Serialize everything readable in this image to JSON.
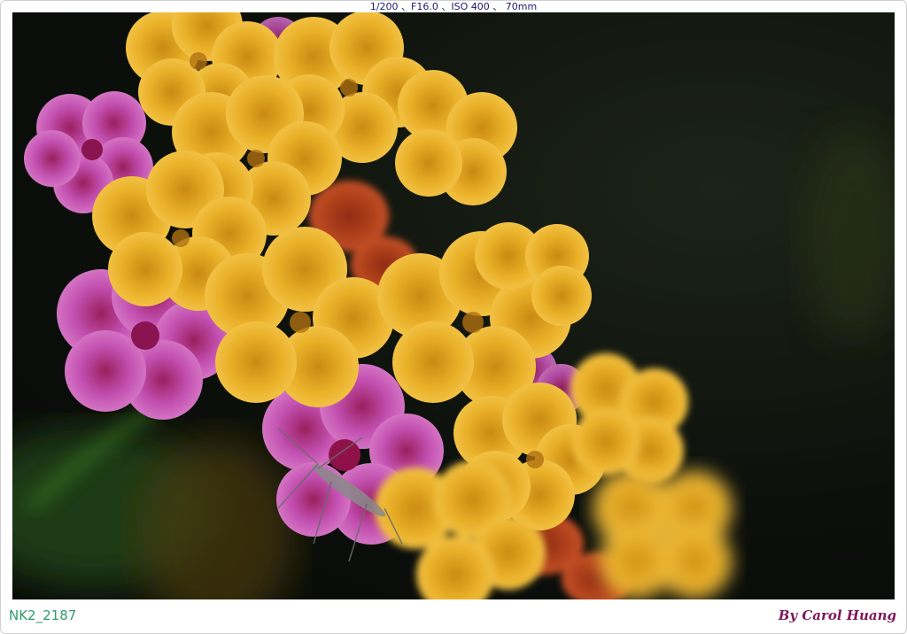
{
  "exif": {
    "text": "1/200 、F16.0 、ISO 400 、 70mm"
  },
  "photo": {
    "subject": "lantana-flower-cluster",
    "colors": {
      "background": "#0c100b",
      "yellow_petal": "#e8a920",
      "yellow_petal_light": "#f4c54a",
      "pink_petal": "#c24fb0",
      "pink_petal_light": "#d978c8",
      "orange_bud": "#c2481e",
      "stem_green": "#2c5a1f"
    }
  },
  "footer": {
    "file_label": "NK2_2187",
    "credit": "By Carol Huang"
  }
}
